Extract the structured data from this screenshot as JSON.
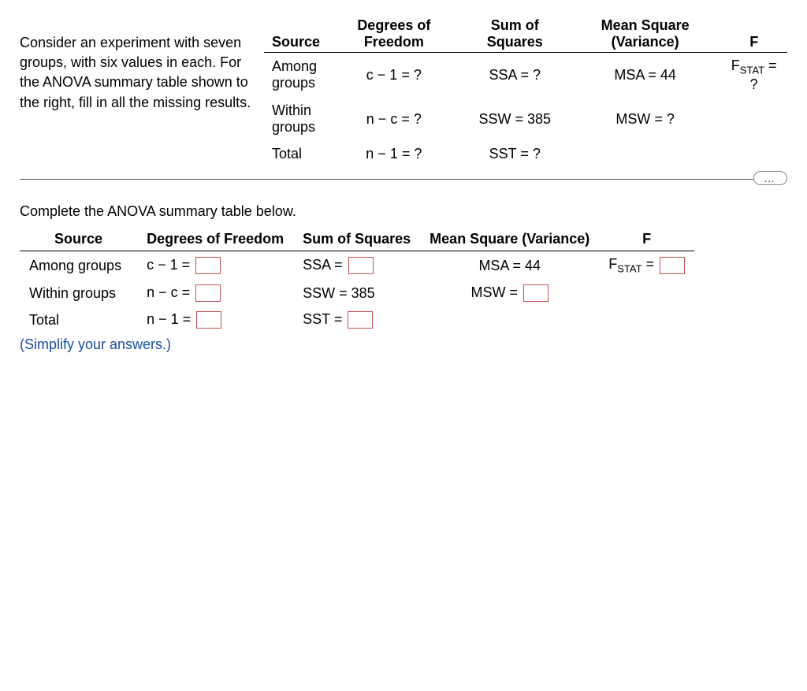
{
  "problem": {
    "text": "Consider an experiment with seven groups, with six values in each. For the ANOVA summary table shown to the right, fill in all the missing results."
  },
  "topTable": {
    "headers": {
      "source": "Source",
      "df": "Degrees of Freedom",
      "ss": "Sum of Squares",
      "ms": "Mean Square (Variance)",
      "f": "F"
    },
    "rows": {
      "among": {
        "src": "Among groups",
        "df": "c − 1 = ?",
        "ss": "SSA = ?",
        "ms": "MSA = 44",
        "f_prefix": "F",
        "f_sub": "STAT",
        "f_suffix": " = ?"
      },
      "within": {
        "src": "Within groups",
        "df": "n − c = ?",
        "ss": "SSW = 385",
        "ms": "MSW = ?"
      },
      "total": {
        "src": "Total",
        "df": "n − 1 = ?",
        "ss": "SST = ?"
      }
    }
  },
  "moreBtn": "…",
  "instruction": "Complete the ANOVA summary table below.",
  "answerTable": {
    "headers": {
      "source": "Source",
      "df": "Degrees of Freedom",
      "ss": "Sum of Squares",
      "ms": "Mean Square (Variance)",
      "f": "F"
    },
    "rows": {
      "among": {
        "src": "Among groups",
        "df": "c − 1 =",
        "ss": "SSA =",
        "ms": "MSA = 44",
        "f_prefix": "F",
        "f_sub": "STAT",
        "f_suffix": " ="
      },
      "within": {
        "src": "Within groups",
        "df": "n − c =",
        "ss": "SSW = 385",
        "ms": "MSW ="
      },
      "total": {
        "src": "Total",
        "df": "n − 1 =",
        "ss": "SST ="
      }
    }
  },
  "simplify": "(Simplify your answers.)"
}
